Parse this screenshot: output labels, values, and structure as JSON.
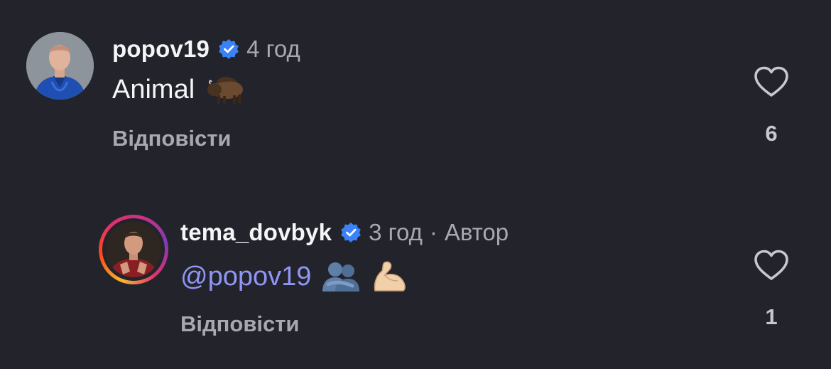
{
  "comments": [
    {
      "username": "popov19",
      "verified": true,
      "time": "4 год",
      "text": "Animal",
      "emojis": [
        "bison-emoji"
      ],
      "reply_label": "Відповісти",
      "likes": "6"
    },
    {
      "username": "tema_dovbyk",
      "verified": true,
      "time": "3 год",
      "separator": "·",
      "author_label": "Автор",
      "mention": "@popov19",
      "emojis": [
        "people-hugging-emoji",
        "flexed-biceps-emoji"
      ],
      "reply_label": "Відповісти",
      "likes": "1"
    }
  ],
  "colors": {
    "background": "#23242b",
    "verified_badge": "#3b82f6",
    "mention": "#8f96f5",
    "secondary_text": "#a8a9b0"
  }
}
